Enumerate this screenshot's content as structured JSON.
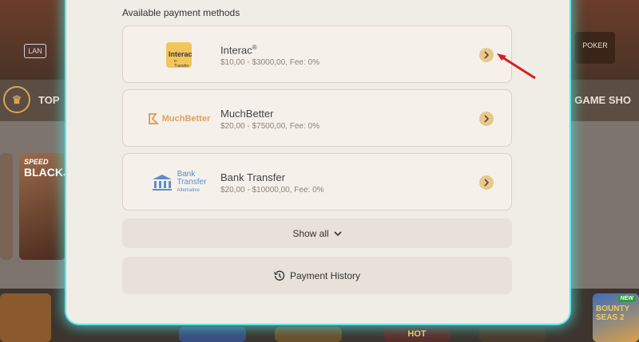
{
  "background": {
    "nav_left_label": "TOP",
    "nav_right_label": "GAME SHO",
    "lan_label": "LAN",
    "poker_label": "POKER",
    "blackjack_small": "SPEED",
    "blackjack_big": "BLACKJA",
    "bounty_badge": "NEW",
    "bounty_title": "BOUNTY SEAS 2",
    "hot_label": "HOT"
  },
  "modal": {
    "section_title": "Available payment methods",
    "methods": [
      {
        "name": "Interac",
        "mark": "®",
        "desc": "$10,00 - $3000,00, Fee: 0%",
        "logo_text": "Interac",
        "logo_sub": "e-Transfer"
      },
      {
        "name": "MuchBetter",
        "desc": "$20,00 - $7500,00, Fee: 0%",
        "logo_text": "MuchBetter"
      },
      {
        "name": "Bank Transfer",
        "desc": "$20,00 - $10000,00, Fee: 0%",
        "logo_line1": "Bank",
        "logo_line2": "Transfer",
        "logo_line3": "Alternative"
      }
    ],
    "show_all_label": "Show all",
    "payment_history_label": "Payment History"
  },
  "colors": {
    "accent": "#e8c88e",
    "glow": "#5fe6e6",
    "annotation_arrow": "#d62020"
  }
}
